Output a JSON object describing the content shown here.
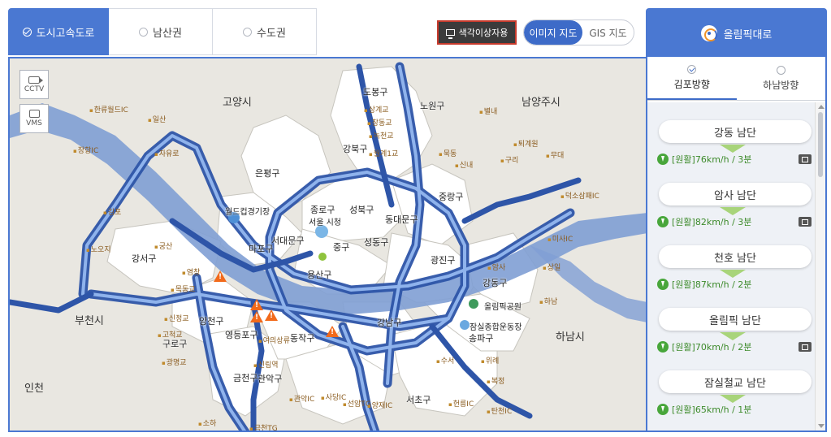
{
  "tabs": [
    {
      "label": "도시고속도로",
      "active": true
    },
    {
      "label": "남산권",
      "active": false
    },
    {
      "label": "수도권",
      "active": false
    }
  ],
  "colorblind_button": "색각이상자용",
  "map_mode": {
    "image": "이미지 지도",
    "gis": "GIS 지도",
    "selected": "image"
  },
  "road_tab": {
    "label": "올림픽대로"
  },
  "map_controls": {
    "cctv": "CCTV",
    "vms": "VMS"
  },
  "map_labels": {
    "cities": [
      "고양시",
      "남양주시",
      "부천시",
      "하남시",
      "인천"
    ],
    "districts": [
      "강북구",
      "도봉구",
      "노원구",
      "은평구",
      "성북구",
      "종로구",
      "중랑구",
      "동대문구",
      "서대문구",
      "마포구",
      "중구",
      "용산구",
      "성동구",
      "광진구",
      "강서구",
      "양천구",
      "영등포구",
      "동작구",
      "구로구",
      "금천구",
      "관악구",
      "서초구",
      "강남구",
      "송파구",
      "강동구"
    ],
    "places": [
      "월드컵경기장",
      "서울 시청",
      "올림픽공원",
      "잠실종합운동장"
    ],
    "ic": [
      "한류월드IC",
      "일산",
      "자유로",
      "장항IC",
      "김포",
      "노오지",
      "궁산",
      "염창",
      "목동교",
      "신정교",
      "고척교",
      "광명교",
      "여의상류",
      "신림역",
      "관악IC",
      "사당IC",
      "선암TG",
      "양재IC",
      "헌릉IC",
      "탄천IC",
      "복정",
      "위례",
      "수서",
      "구리",
      "퇴계원",
      "무대",
      "덕소삼패IC",
      "미사IC",
      "상일",
      "하남",
      "암사",
      "별내",
      "신내",
      "묵동",
      "상계교",
      "창동교",
      "녹천교",
      "월계1교",
      "소하",
      "금천TG"
    ]
  },
  "directions": [
    {
      "label": "김포방향",
      "selected": true
    },
    {
      "label": "하남방향",
      "selected": false
    }
  ],
  "segments": [
    {
      "name": "강동 남단",
      "status": "[원활]76km/h / 3분"
    },
    {
      "name": "암사 남단",
      "status": "[원활]82km/h / 3분"
    },
    {
      "name": "천호 남단",
      "status": "[원활]87km/h / 2분"
    },
    {
      "name": "올림픽 남단",
      "status": "[원활]70km/h / 2분"
    },
    {
      "name": "잠실철교 남단",
      "status": "[원활]65km/h / 1분"
    }
  ],
  "colors": {
    "primary": "#4a78d2",
    "road": "#3a6ac4",
    "river": "#7f9fd4",
    "land": "#e9e7e1",
    "district": "#ffffff",
    "ok": "#48a63b",
    "alert": "#f26a1b"
  }
}
